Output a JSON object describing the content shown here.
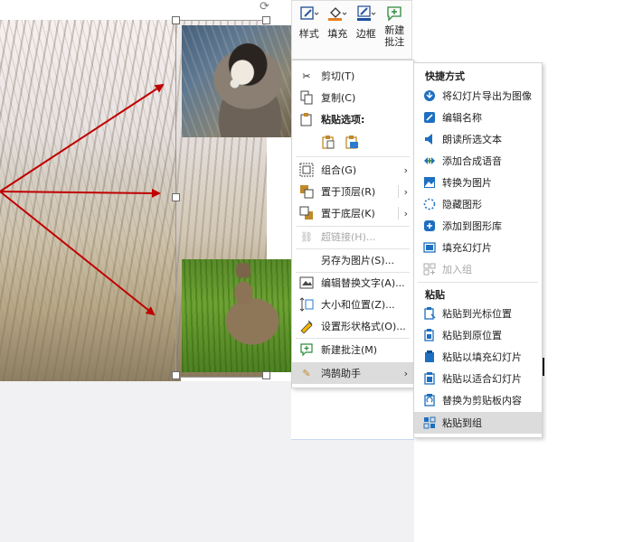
{
  "toolbar": {
    "style_label": "样式",
    "fill_label": "填充",
    "border_label": "边框",
    "new_comment_label_line1": "新建",
    "new_comment_label_line2": "批注"
  },
  "context_menu": {
    "cut": "剪切(T)",
    "copy": "复制(C)",
    "paste_options": "粘贴选项:",
    "group": "组合(G)",
    "bring_to_front": "置于顶层(R)",
    "send_to_back": "置于底层(K)",
    "hyperlink": "超链接(H)...",
    "save_as_picture": "另存为图片(S)...",
    "edit_alt_text": "编辑替换文字(A)...",
    "size_and_position": "大小和位置(Z)...",
    "format_shape": "设置形状格式(O)...",
    "new_comment": "新建批注(M)",
    "hongpeng_helper": "鸿鹄助手"
  },
  "submenu": {
    "shortcuts_header": "快捷方式",
    "items": [
      {
        "label": "将幻灯片导出为图像"
      },
      {
        "label": "编辑名称"
      },
      {
        "label": "朗读所选文本"
      },
      {
        "label": "添加合成语音"
      },
      {
        "label": "转换为图片"
      },
      {
        "label": "隐藏图形"
      },
      {
        "label": "添加到图形库"
      },
      {
        "label": "填充幻灯片"
      },
      {
        "label": "加入组"
      }
    ],
    "paste_header": "粘贴",
    "paste_items": [
      {
        "label": "粘贴到光标位置"
      },
      {
        "label": "粘贴到原位置"
      },
      {
        "label": "粘贴以填充幻灯片"
      },
      {
        "label": "粘贴以适合幻灯片"
      },
      {
        "label": "替换为剪贴板内容"
      },
      {
        "label": "粘贴到组"
      }
    ]
  },
  "colors": {
    "arrow": "#c00000",
    "accent_blue": "#1e6fc0",
    "highlight": "#dcdcdc"
  }
}
